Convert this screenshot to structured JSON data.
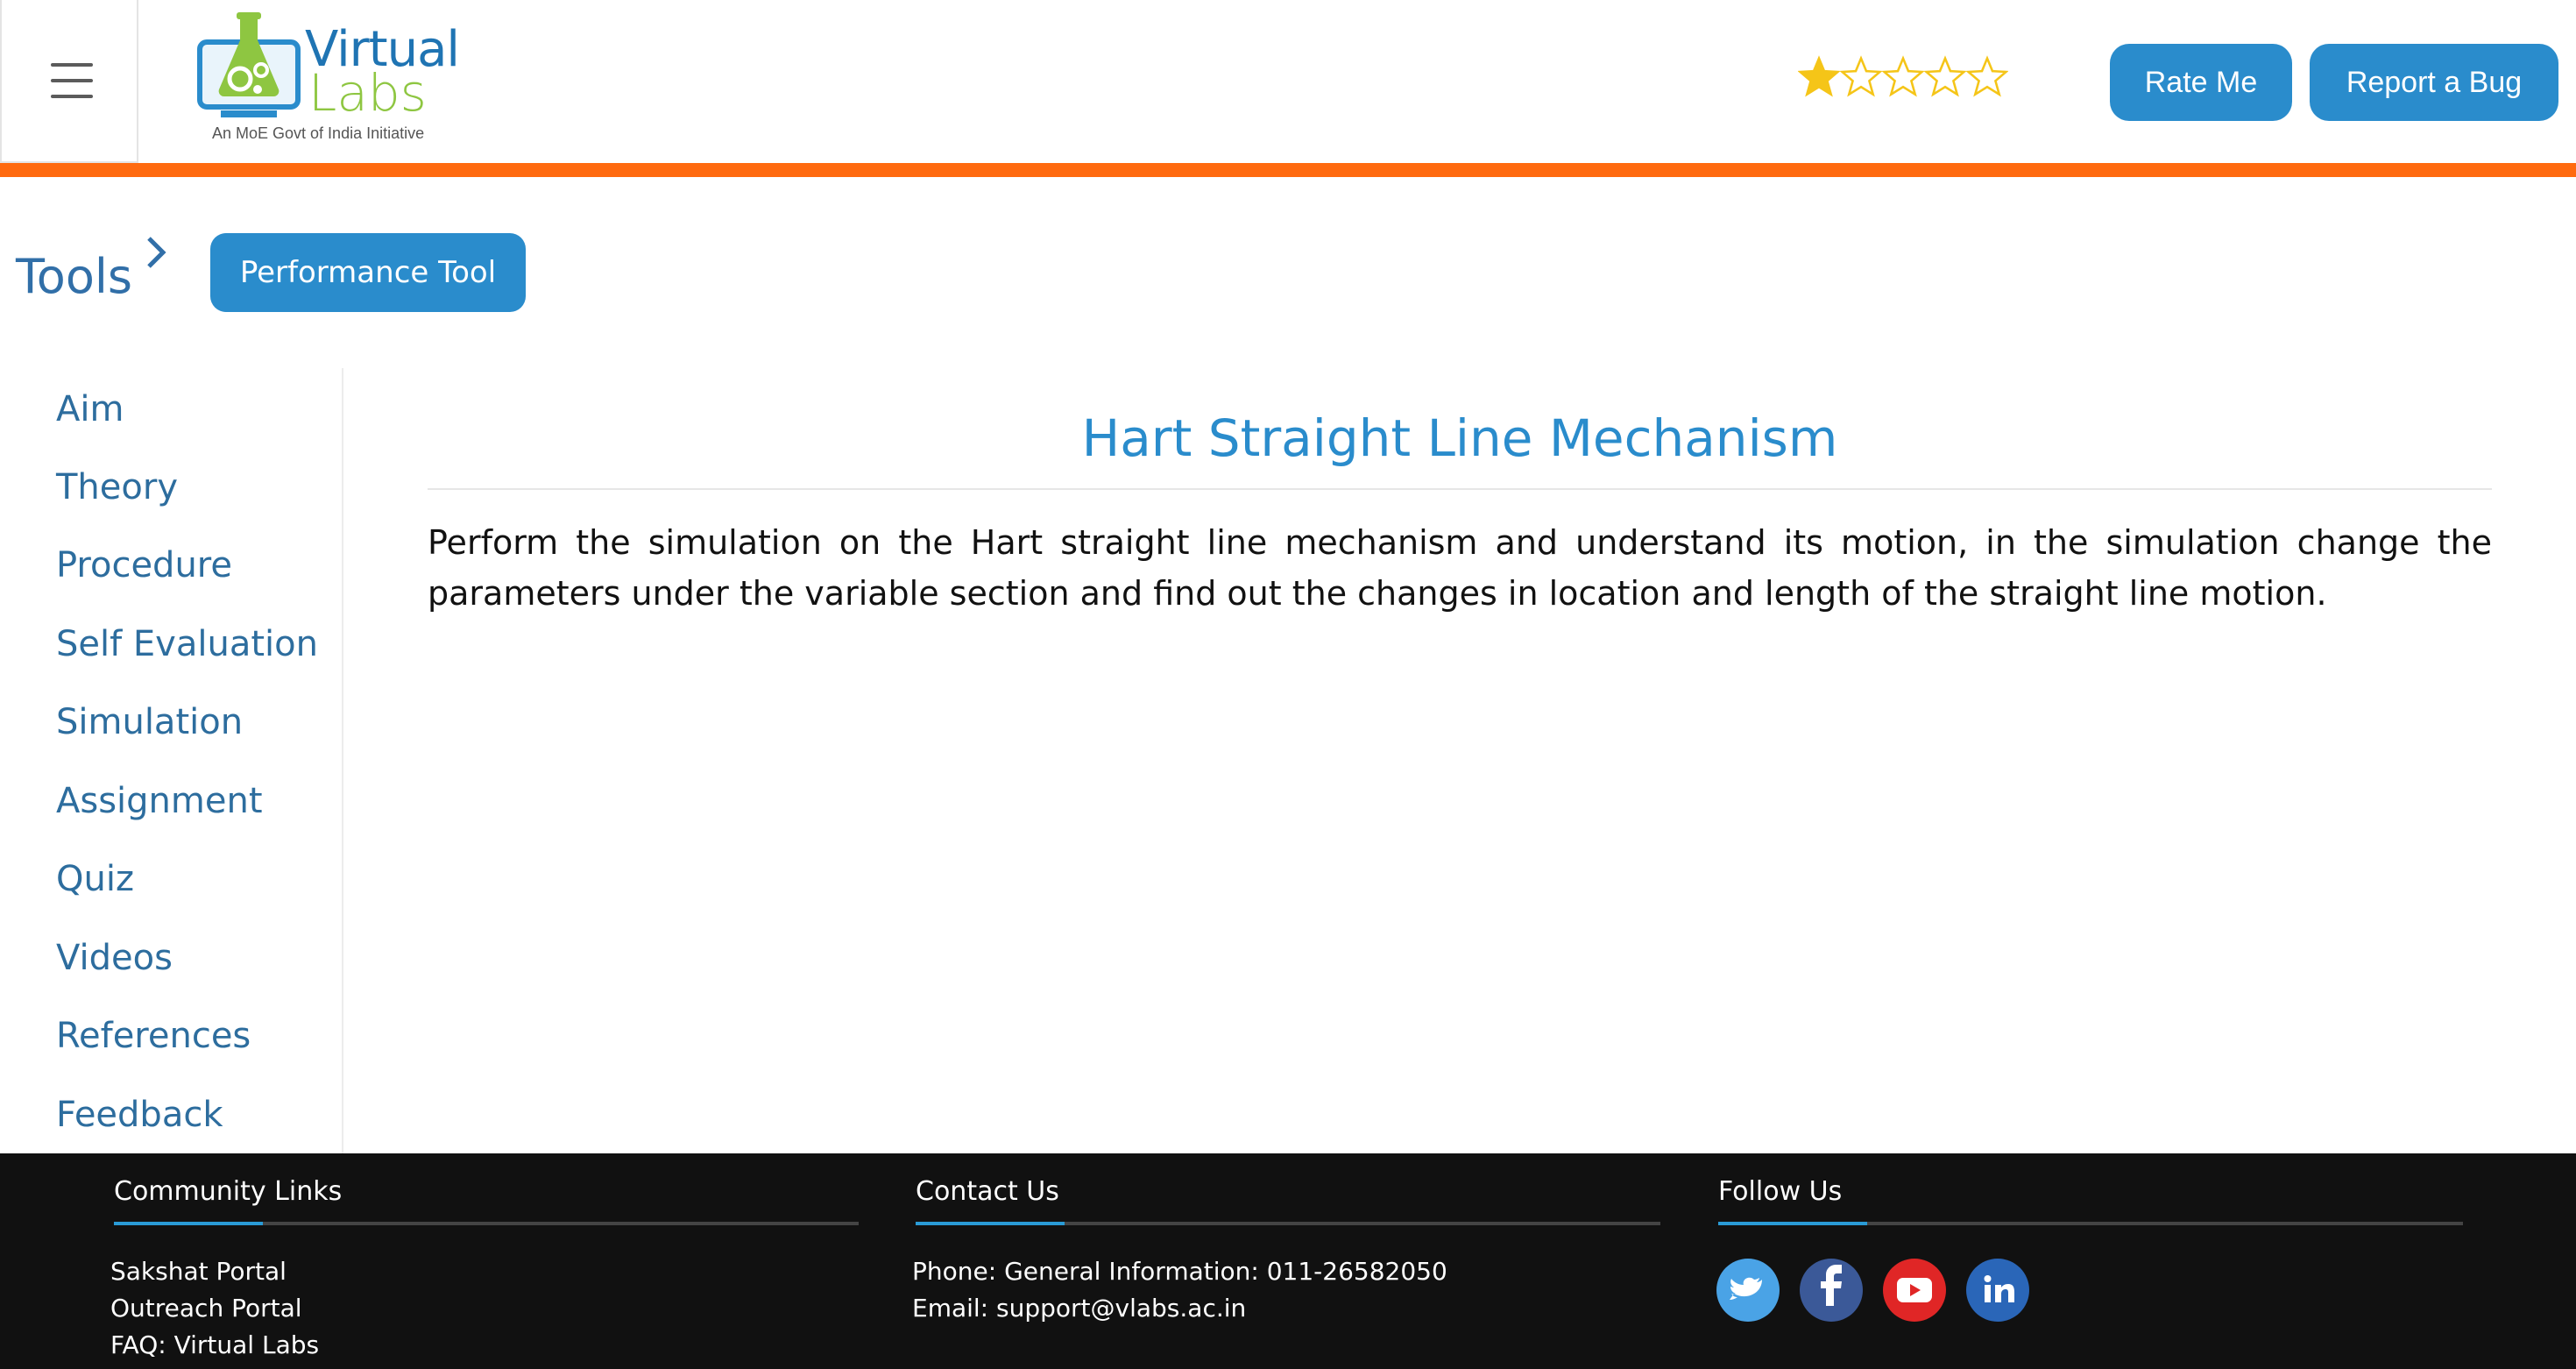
{
  "header": {
    "logo": {
      "word1": "Virtual",
      "word2": "Labs",
      "tagline": "An MoE Govt of India Initiative"
    },
    "rating": {
      "value": 1,
      "max": 5
    },
    "rate_label": "Rate Me",
    "bug_label": "Report a Bug",
    "colors": {
      "accent_bar": "#ff6a0f",
      "button": "#2a8ccc",
      "star": "#f5c518"
    }
  },
  "breadcrumb": {
    "root": "Tools",
    "current": "Performance Tool"
  },
  "sidebar": {
    "items": [
      {
        "label": "Aim",
        "active": true
      },
      {
        "label": "Theory"
      },
      {
        "label": "Procedure"
      },
      {
        "label": "Self Evaluation"
      },
      {
        "label": "Simulation"
      },
      {
        "label": "Assignment"
      },
      {
        "label": "Quiz"
      },
      {
        "label": "Videos"
      },
      {
        "label": "References"
      },
      {
        "label": "Feedback"
      }
    ]
  },
  "main": {
    "title": "Hart Straight Line Mechanism",
    "body": "Perform the simulation on the Hart straight line mechanism and understand its motion, in the simulation change the parameters under the variable section and find out the changes in location and length of the straight line motion."
  },
  "footer": {
    "community": {
      "heading": "Community Links",
      "links": [
        "Sakshat Portal",
        "Outreach Portal",
        "FAQ: Virtual Labs"
      ]
    },
    "contact": {
      "heading": "Contact Us",
      "phone": "Phone: General Information: 011-26582050",
      "email": "Email: support@vlabs.ac.in"
    },
    "follow": {
      "heading": "Follow Us",
      "icons": [
        {
          "name": "twitter-icon",
          "color": "#4aa3e6"
        },
        {
          "name": "facebook-icon",
          "color": "#3b5998"
        },
        {
          "name": "youtube-icon",
          "color": "#e02626"
        },
        {
          "name": "linkedin-icon",
          "color": "#2a66b8"
        }
      ]
    }
  }
}
